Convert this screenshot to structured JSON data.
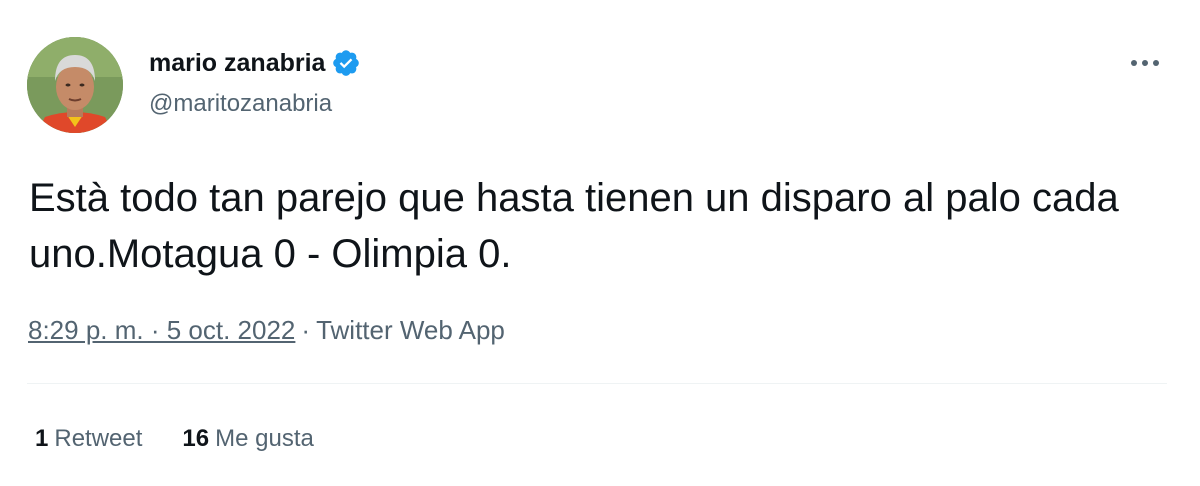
{
  "author": {
    "name": "mario zanabria",
    "handle": "@maritozanabria",
    "verified_color": "#1d9bf0"
  },
  "tweet": {
    "text": "Està todo tan parejo que hasta tienen un disparo al palo cada uno.Motagua 0 - Olimpia 0.",
    "timestamp": "8:29 p. m. · 5 oct. 2022",
    "separator": "·",
    "source": "Twitter Web App"
  },
  "stats": {
    "retweets_count": "1",
    "retweets_label": "Retweet",
    "likes_count": "16",
    "likes_label": "Me gusta"
  },
  "icons": {
    "more": "more-horizontal-icon",
    "verified": "verified-badge-icon"
  }
}
